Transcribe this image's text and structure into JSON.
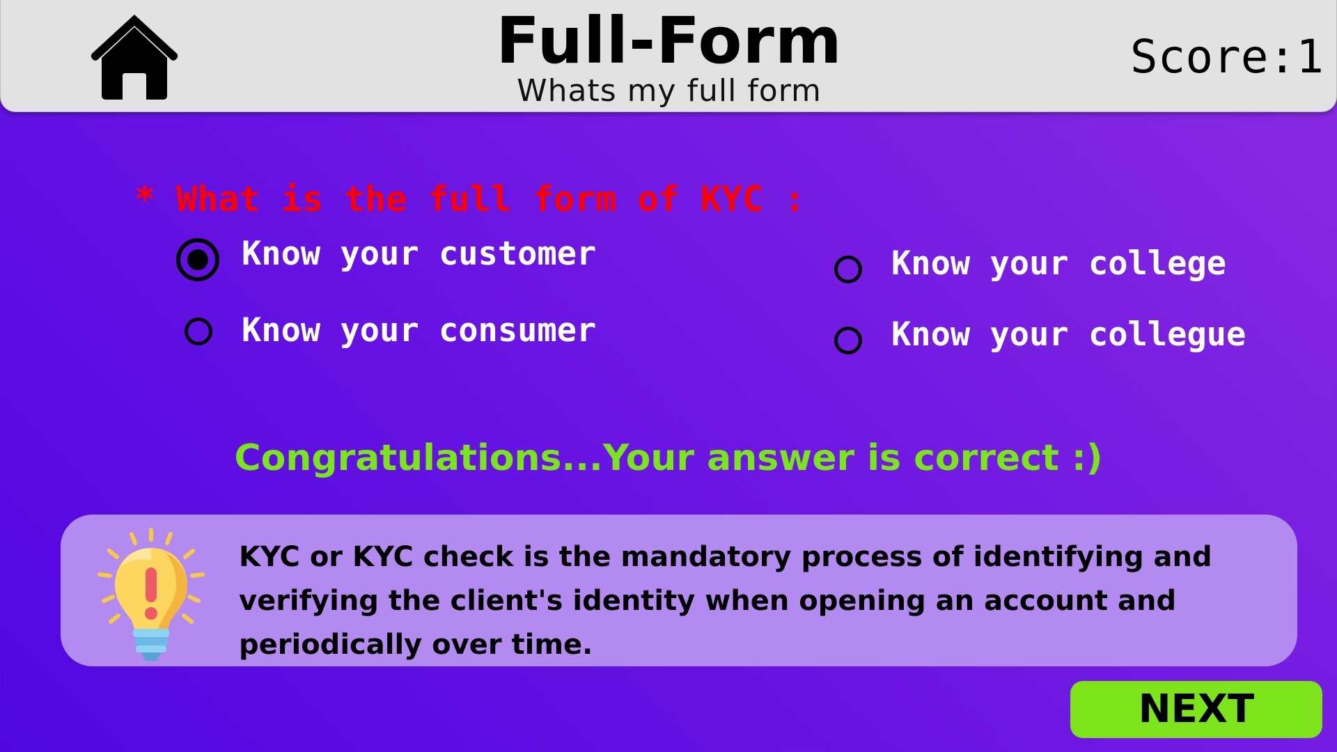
{
  "header": {
    "home_icon": "home-icon",
    "title": "Full-Form",
    "subtitle": "Whats my full form",
    "score": "Score:1"
  },
  "question": {
    "text": "* What is the full form of KYC :",
    "options": [
      {
        "label": "Know your customer",
        "selected": true
      },
      {
        "label": "Know your consumer",
        "selected": false
      },
      {
        "label": "Know your college",
        "selected": false
      },
      {
        "label": "Know your collegue",
        "selected": false
      }
    ]
  },
  "feedback": {
    "text": "Congratulations...Your answer is correct :)"
  },
  "explanation": {
    "icon": "lightbulb-icon",
    "text": "KYC or KYC check is the mandatory process of identifying and verifying the client's identity when opening an account and periodically over time."
  },
  "next_button": {
    "label": "NEXT"
  },
  "colors": {
    "background_start": "#4f07e0",
    "background_end": "#8a2be2",
    "question": "#ff0000",
    "feedback": "#7be51c",
    "card": "#b38bf0",
    "next_button": "#7de31b"
  }
}
